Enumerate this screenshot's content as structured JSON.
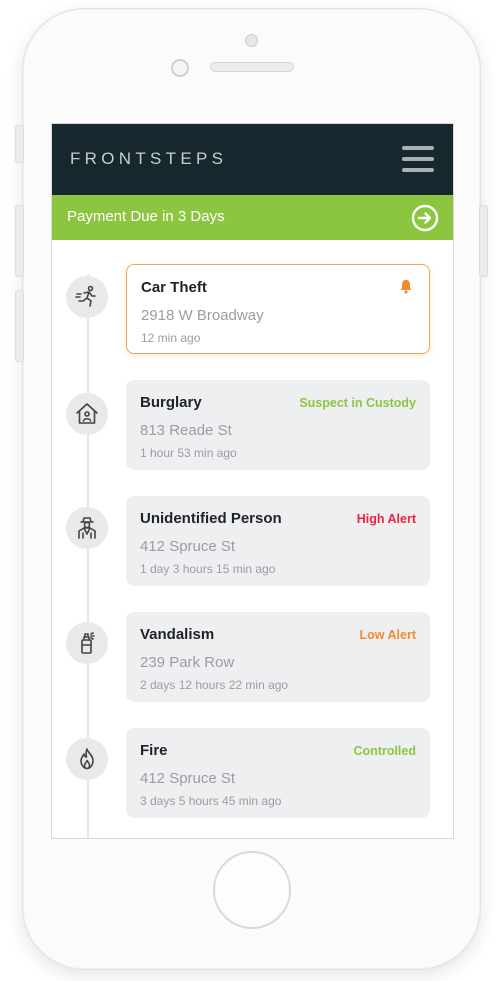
{
  "app": {
    "logo": "FRONTSTEPS"
  },
  "banner": {
    "text": "Payment Due in 3 Days"
  },
  "colors": {
    "header_bg": "#16272e",
    "banner_bg": "#8cc641",
    "green_status": "#8cc641",
    "red_status": "#e8253f",
    "orange_status": "#f28a2e",
    "active_border": "#f2a65a"
  },
  "incidents": [
    {
      "title": "Car Theft",
      "address": "2918 W Broadway",
      "time": "12 min ago",
      "status": "",
      "icon": "running-person-icon",
      "active": true
    },
    {
      "title": "Burglary",
      "address": "813 Reade St",
      "time": "1 hour 53 min ago",
      "status": "Suspect in Custody",
      "status_color": "#8cc641",
      "icon": "house-icon"
    },
    {
      "title": "Unidentified Person",
      "address": "412 Spruce St",
      "time": "1 day 3 hours 15 min ago",
      "status": "High Alert",
      "status_color": "#e8253f",
      "icon": "hooded-person-icon"
    },
    {
      "title": "Vandalism",
      "address": "239 Park Row",
      "time": "2 days 12 hours 22 min ago",
      "status": "Low Alert",
      "status_color": "#f28a2e",
      "icon": "spray-can-icon"
    },
    {
      "title": "Fire",
      "address": "412 Spruce St",
      "time": "3 days 5 hours 45 min ago",
      "status": "Controlled",
      "status_color": "#8cc641",
      "icon": "flame-icon"
    }
  ]
}
